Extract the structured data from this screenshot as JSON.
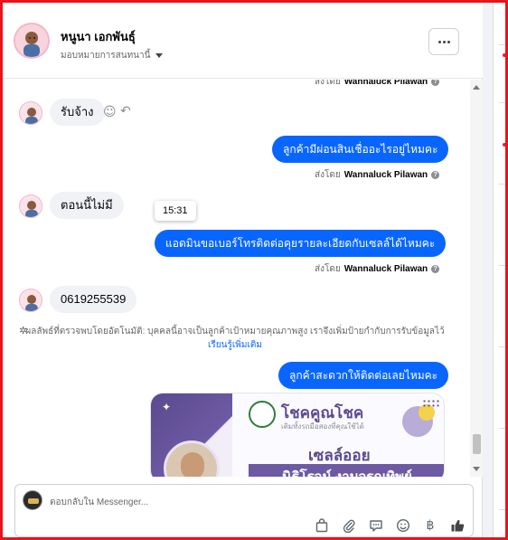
{
  "header": {
    "contact_name": "หนูนา เอกพันธุ์",
    "assign_label": "มอบหมายการสนทนานี้",
    "more_label": "···"
  },
  "messages": {
    "top_sent_by_prefix": "ส่งโดย",
    "top_sent_by_name": "Wannaluck Pilawan",
    "in_1": "รับจ้าง",
    "out_1": "ลูกค้ามีผ่อนสินเชื่ออะไรอยู่ไหมคะ",
    "sent_by_prefix": "ส่งโดย",
    "sent_by_name": "Wannaluck Pilawan",
    "in_2": "ตอนนี้ไม่มี",
    "time_tooltip": "15:31",
    "out_2": "แอดมินขอเบอร์โทรติดต่อคุยรายละเอียดกับเซลล์ได้ไหมคะ",
    "in_3": "0619255539",
    "auto_note": "ผลลัพธ์ที่ตรวจพบโดยอัตโนมัติ: บุคคลนี้อาจเป็นลูกค้าเป้าหมายคุณภาพสูง เราจึงเพิ่มป้ายกำกับการรับข้อมูลไว้",
    "auto_note_link": "เรียนรู้เพิ่มเติม",
    "out_3": "ลูกค้าสะดวกให้ติดต่อเลยไหมคะ"
  },
  "image_card": {
    "brand": "โชคคูณโชค",
    "tagline": "เติมทั้งรถมือสองที่คุณใช้ได้",
    "title": "เซลล์ออย",
    "person_name": "นิธิโรจน์  งามจรณทิพย์"
  },
  "composer": {
    "placeholder": "ตอบกลับใน Messenger..."
  },
  "icons": {
    "more": "more-icon",
    "react": "smiley-icon",
    "reply": "reply-icon",
    "info": "info-icon",
    "auto": "sparkle-icon",
    "shop": "shopping-bag-icon",
    "attach": "paperclip-icon",
    "saved_replies": "chat-bubble-icon",
    "emoji": "emoji-icon",
    "payment": "baht-icon",
    "like": "thumbs-up-icon"
  },
  "colors": {
    "accent": "#0866ff",
    "incoming_bubble": "#f0f2f5",
    "frame": "#e8141c",
    "card_purple": "#6d5aa3"
  }
}
